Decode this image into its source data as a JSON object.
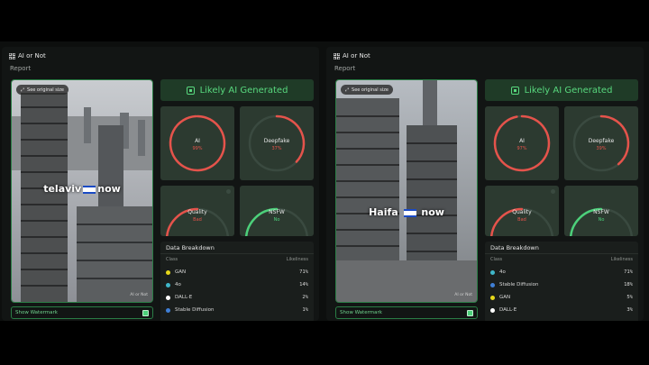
{
  "panels": [
    {
      "brand": "AI or Not",
      "report": "Report",
      "see_original": "See original size",
      "overlay_text_before": "telaviv",
      "overlay_text_after": "now",
      "watermark_tag": "AI or Not",
      "show_watermark": "Show Watermark",
      "verdict": "Likely AI Generated",
      "cards": [
        {
          "label": "AI",
          "value": "99%",
          "level": 0.99,
          "color": "#e5534b"
        },
        {
          "label": "Deepfake",
          "value": "37%",
          "level": 0.37,
          "color": "#e5534b"
        },
        {
          "label": "Quality",
          "value": "Bad",
          "level": 0.5,
          "color": "#e5534b"
        },
        {
          "label": "NSFW",
          "value": "No",
          "level": 0.5,
          "color": "#4cd07a"
        }
      ],
      "breakdown_title": "Data Breakdown",
      "col_class": "Class",
      "col_likeliness": "Likeliness",
      "rows": [
        {
          "name": "GAN",
          "value": "71%",
          "color": "#e6d81a"
        },
        {
          "name": "4o",
          "value": "14%",
          "color": "#3fb7c9"
        },
        {
          "name": "DALL·E",
          "value": "2%",
          "color": "#ffffff"
        },
        {
          "name": "Stable Diffusion",
          "value": "1%",
          "color": "#3f7fd6"
        }
      ]
    },
    {
      "brand": "AI or Not",
      "report": "Report",
      "see_original": "See original size",
      "overlay_text_before": "Haifa",
      "overlay_text_after": "now",
      "watermark_tag": "AI or Not",
      "show_watermark": "Show Watermark",
      "verdict": "Likely AI Generated",
      "cards": [
        {
          "label": "AI",
          "value": "97%",
          "level": 0.97,
          "color": "#e5534b"
        },
        {
          "label": "Deepfake",
          "value": "39%",
          "level": 0.39,
          "color": "#e5534b"
        },
        {
          "label": "Quality",
          "value": "Bad",
          "level": 0.5,
          "color": "#e5534b"
        },
        {
          "label": "NSFW",
          "value": "No",
          "level": 0.5,
          "color": "#4cd07a"
        }
      ],
      "breakdown_title": "Data Breakdown",
      "col_class": "Class",
      "col_likeliness": "Likeliness",
      "rows": [
        {
          "name": "4o",
          "value": "71%",
          "color": "#3fb7c9"
        },
        {
          "name": "Stable Diffusion",
          "value": "18%",
          "color": "#3f7fd6"
        },
        {
          "name": "GAN",
          "value": "5%",
          "color": "#e6d81a"
        },
        {
          "name": "DALL·E",
          "value": "3%",
          "color": "#ffffff"
        }
      ]
    }
  ]
}
